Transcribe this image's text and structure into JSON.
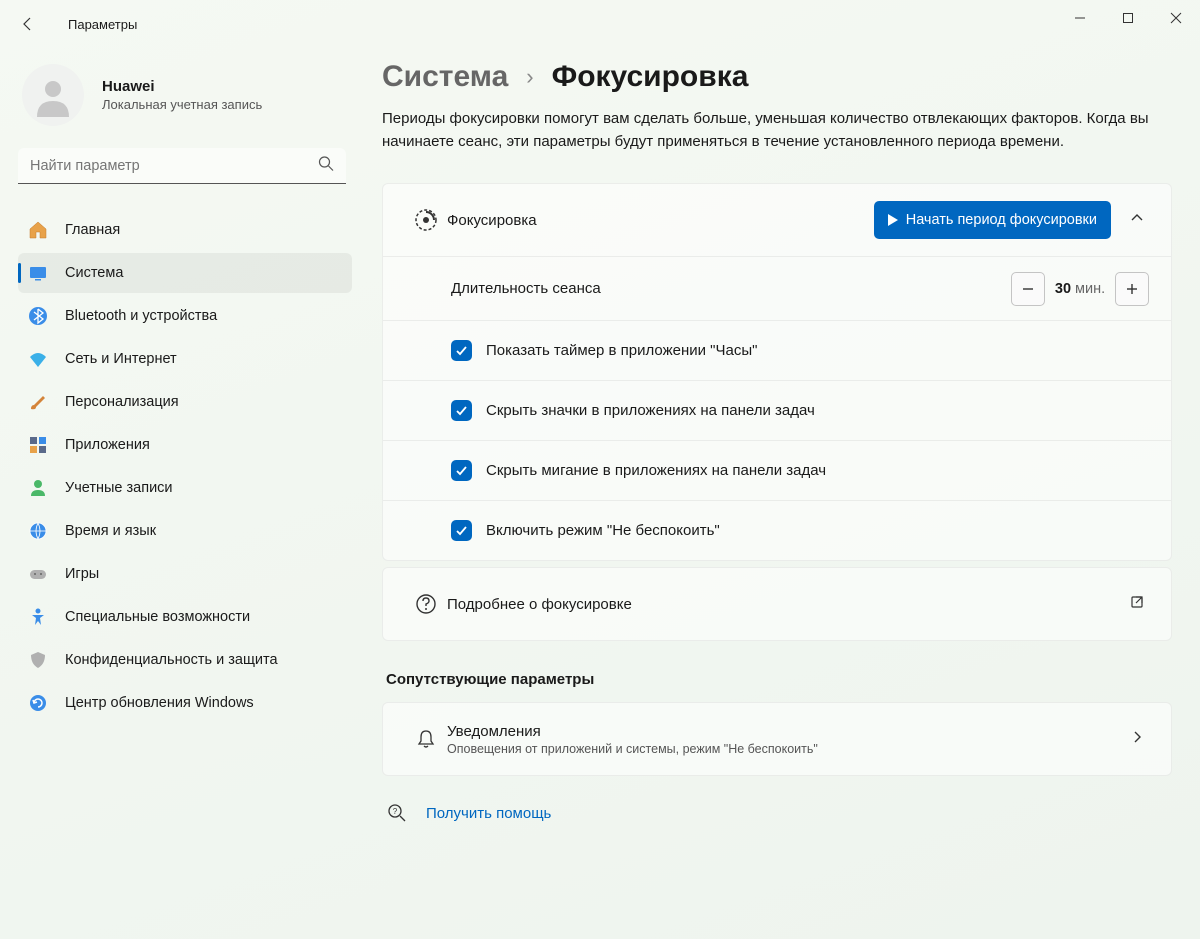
{
  "app_title": "Параметры",
  "user": {
    "name": "Huawei",
    "sub": "Локальная учетная запись"
  },
  "search": {
    "placeholder": "Найти параметр"
  },
  "nav": [
    {
      "label": "Главная"
    },
    {
      "label": "Система"
    },
    {
      "label": "Bluetooth и устройства"
    },
    {
      "label": "Сеть и Интернет"
    },
    {
      "label": "Персонализация"
    },
    {
      "label": "Приложения"
    },
    {
      "label": "Учетные записи"
    },
    {
      "label": "Время и язык"
    },
    {
      "label": "Игры"
    },
    {
      "label": "Специальные возможности"
    },
    {
      "label": "Конфиденциальность и защита"
    },
    {
      "label": "Центр обновления Windows"
    }
  ],
  "nav_selected_index": 1,
  "breadcrumb": {
    "parent": "Система",
    "current": "Фокусировка"
  },
  "description": "Периоды фокусировки помогут вам сделать больше, уменьшая количество отвлекающих факторов. Когда вы начинаете сеанс, эти параметры будут применяться в течение установленного периода времени.",
  "focus": {
    "title": "Фокусировка",
    "start_button": "Начать период фокусировки",
    "duration_label": "Длительность сеанса",
    "duration_value": "30",
    "duration_unit": "мин.",
    "check1": "Показать таймер в приложении \"Часы\"",
    "check2": "Скрыть значки в приложениях на панели задач",
    "check3": "Скрыть мигание в приложениях на панели задач",
    "check4": "Включить режим \"Не беспокоить\"",
    "learn_more": "Подробнее о фокусировке"
  },
  "related": {
    "heading": "Сопутствующие параметры",
    "notifications_title": "Уведомления",
    "notifications_sub": "Оповещения от приложений и системы, режим \"Не беспокоить\""
  },
  "help_link": "Получить помощь",
  "colors": {
    "accent": "#0067c0"
  }
}
